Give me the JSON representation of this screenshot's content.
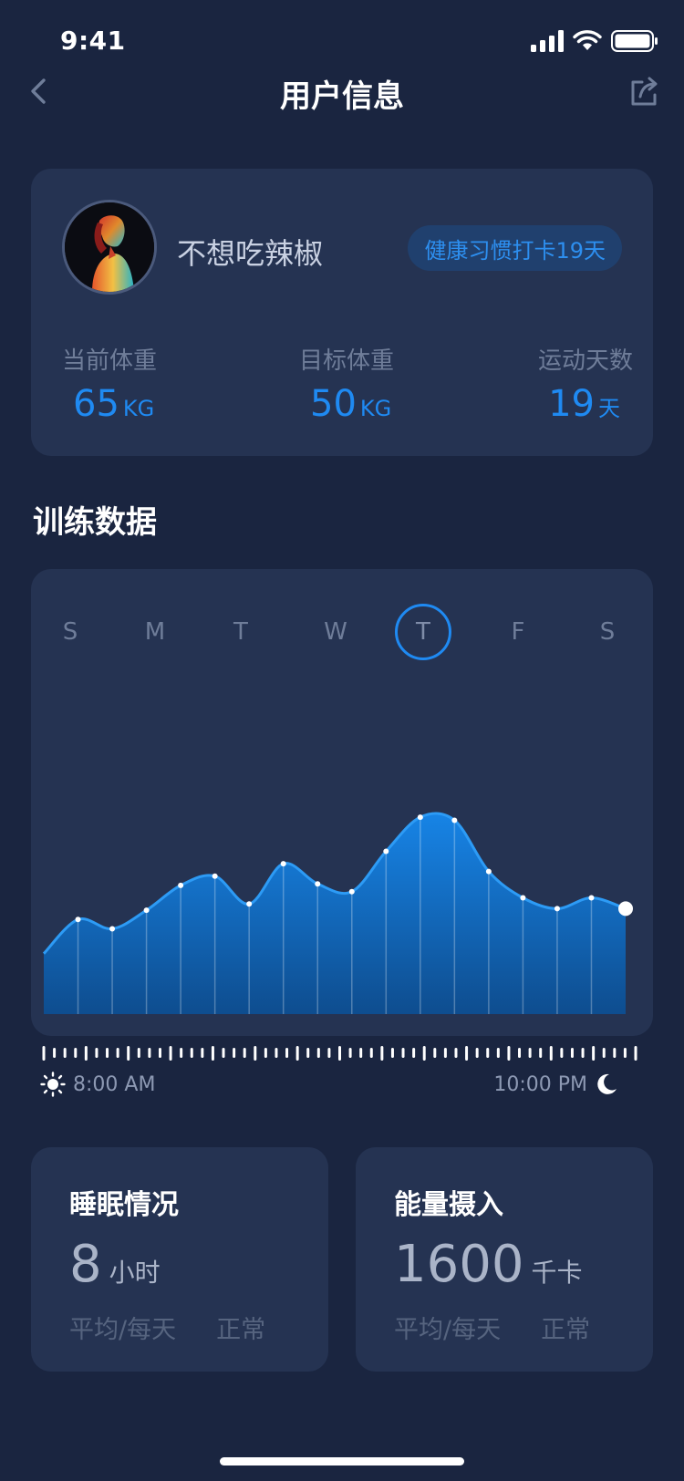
{
  "status_bar": {
    "time": "9:41"
  },
  "nav": {
    "title": "用户信息"
  },
  "profile": {
    "username": "不想吃辣椒",
    "badge": "健康习惯打卡19天",
    "stats": [
      {
        "label": "当前体重",
        "value": "65",
        "unit": "KG"
      },
      {
        "label": "目标体重",
        "value": "50",
        "unit": "KG"
      },
      {
        "label": "运动天数",
        "value": "19",
        "unit": "天"
      }
    ]
  },
  "training": {
    "title": "训练数据",
    "days": [
      "S",
      "M",
      "T",
      "W",
      "T",
      "F",
      "S"
    ],
    "selected_day_index": 4,
    "start_time": "8:00 AM",
    "end_time": "10:00 PM"
  },
  "chart_data": {
    "type": "area",
    "title": "",
    "xlabel": "",
    "ylabel": "",
    "values": [
      0.39,
      0.61,
      0.55,
      0.67,
      0.83,
      0.89,
      0.71,
      0.97,
      0.84,
      0.79,
      1.05,
      1.27,
      1.25,
      0.92,
      0.75,
      0.68,
      0.75,
      0.68
    ],
    "fill_color": "#1173d4",
    "line_color": "#2d9bf5"
  },
  "sleep": {
    "title": "睡眠情况",
    "value": "8",
    "unit": "小时",
    "period": "平均/每天",
    "status": "正常"
  },
  "energy": {
    "title": "能量摄入",
    "value": "1600",
    "unit": "千卡",
    "period": "平均/每天",
    "status": "正常"
  },
  "colors": {
    "background": "#1a2540",
    "card": "#253352",
    "accent": "#1f8af2"
  }
}
